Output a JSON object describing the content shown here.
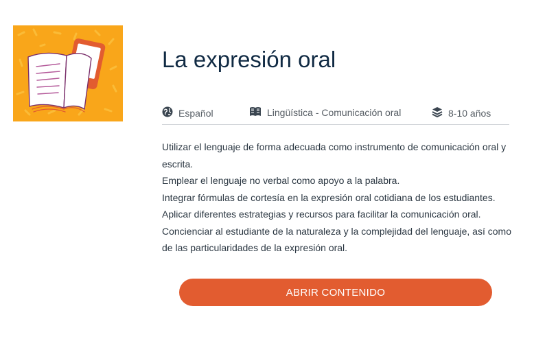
{
  "course": {
    "title": "La expresión oral",
    "thumbnail_icon": "book-and-tablet-illustration",
    "colors": {
      "thumbnail_bg": "#f9a61a",
      "accent": "#e25c30"
    }
  },
  "meta": {
    "language": {
      "icon": "globe-icon",
      "text": "Español"
    },
    "subject": {
      "icon": "open-book-icon",
      "text": "Lingüística - Comunicación oral"
    },
    "age": {
      "icon": "layers-icon",
      "text": "8-10 años"
    }
  },
  "objectives": [
    "Utilizar el lenguaje de forma adecuada como instrumento de comunicación oral y escrita.",
    "Emplear el lenguaje no verbal como apoyo a la palabra.",
    "Integrar fórmulas de cortesía en la expresión oral cotidiana de los estudiantes.",
    "Aplicar diferentes estrategias y recursos para facilitar la comunicación oral.",
    "Concienciar al estudiante de la naturaleza y la complejidad del lenguaje, así como de las particularidades de la expresión oral."
  ],
  "actions": {
    "open_label": "ABRIR CONTENIDO"
  }
}
